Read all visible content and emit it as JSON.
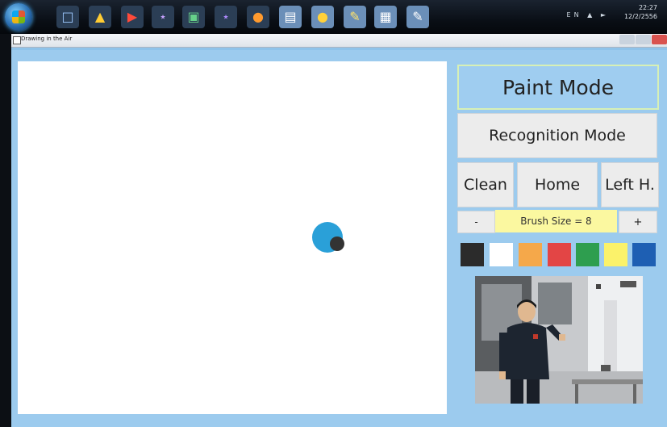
{
  "taskbar": {
    "tray_lang": "EN",
    "clock_time": "22:27",
    "clock_date": "12/2/2556"
  },
  "window": {
    "title": "Drawing in the Air"
  },
  "panel": {
    "paint_mode": "Paint Mode",
    "recognition_mode": "Recognition Mode",
    "clean": "Clean",
    "home": "Home",
    "left_hand": "Left H.",
    "minus": "-",
    "plus": "+",
    "brush_size": "Brush Size = 8"
  },
  "palette": [
    {
      "name": "black",
      "color": "#2b2b2b"
    },
    {
      "name": "white",
      "color": "#ffffff"
    },
    {
      "name": "orange",
      "color": "#f5a84a"
    },
    {
      "name": "red",
      "color": "#e34545"
    },
    {
      "name": "green",
      "color": "#2e9e4f"
    },
    {
      "name": "yellow",
      "color": "#fbf26a"
    },
    {
      "name": "blue",
      "color": "#1e5fb3"
    }
  ],
  "colors": {
    "cursor_ring": "#2aa0d8",
    "panel_bg": "#9ccbee",
    "brush_label_bg": "#fbf8a0"
  }
}
